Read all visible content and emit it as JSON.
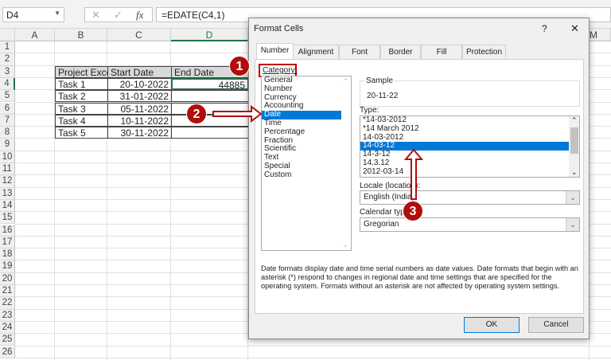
{
  "formula_bar": {
    "name_box": "D4",
    "formula": "=EDATE(C4,1)",
    "cancel_icon": "✕",
    "enter_icon": "✓",
    "fx_icon": "fx"
  },
  "columns": [
    "A",
    "B",
    "C",
    "D",
    "M"
  ],
  "rows": [
    "1",
    "2",
    "3",
    "4",
    "5",
    "6",
    "7",
    "8",
    "9",
    "10",
    "11",
    "12",
    "13",
    "14",
    "15",
    "16",
    "17",
    "18",
    "19",
    "20",
    "21",
    "22",
    "23",
    "24",
    "25",
    "26"
  ],
  "table": {
    "headers": [
      "Project Excel",
      "Start Date",
      "End Date"
    ],
    "rows": [
      [
        "Task 1",
        "20-10-2022",
        "44885"
      ],
      [
        "Task 2",
        "31-01-2022",
        ""
      ],
      [
        "Task 3",
        "05-11-2022",
        ""
      ],
      [
        "Task 4",
        "10-11-2022",
        ""
      ],
      [
        "Task 5",
        "30-11-2022",
        ""
      ]
    ]
  },
  "dialog": {
    "title": "Format Cells",
    "help": "?",
    "close": "✕",
    "tabs": [
      "Number",
      "Alignment",
      "Font",
      "Border",
      "Fill",
      "Protection"
    ],
    "category_label": "Category:",
    "categories": [
      "General",
      "Number",
      "Currency",
      "Accounting",
      "Date",
      "Time",
      "Percentage",
      "Fraction",
      "Scientific",
      "Text",
      "Special",
      "Custom"
    ],
    "selected_category": "Date",
    "sample_label": "Sample",
    "sample_value": "20-11-22",
    "type_label": "Type:",
    "types": [
      "*14-03-2012",
      "*14 March 2012",
      "14-03-2012",
      "14-03-12",
      "14-3-12",
      "14.3.12",
      "2012-03-14"
    ],
    "selected_type": "14-03-12",
    "locale_label": "Locale (location):",
    "locale_value": "English (India)",
    "calendar_label": "Calendar type:",
    "calendar_value": "Gregorian",
    "description": "Date formats display date and time serial numbers as date values.  Date formats that begin with an asterisk (*) respond to changes in regional date and time settings that are specified for the operating system. Formats without an asterisk are not affected by operating system settings.",
    "ok": "OK",
    "cancel": "Cancel"
  },
  "annotations": [
    "1",
    "2",
    "3"
  ],
  "colors": {
    "accent": "#0078d7",
    "annotation": "#b00d0d",
    "selection_green": "#217346"
  }
}
